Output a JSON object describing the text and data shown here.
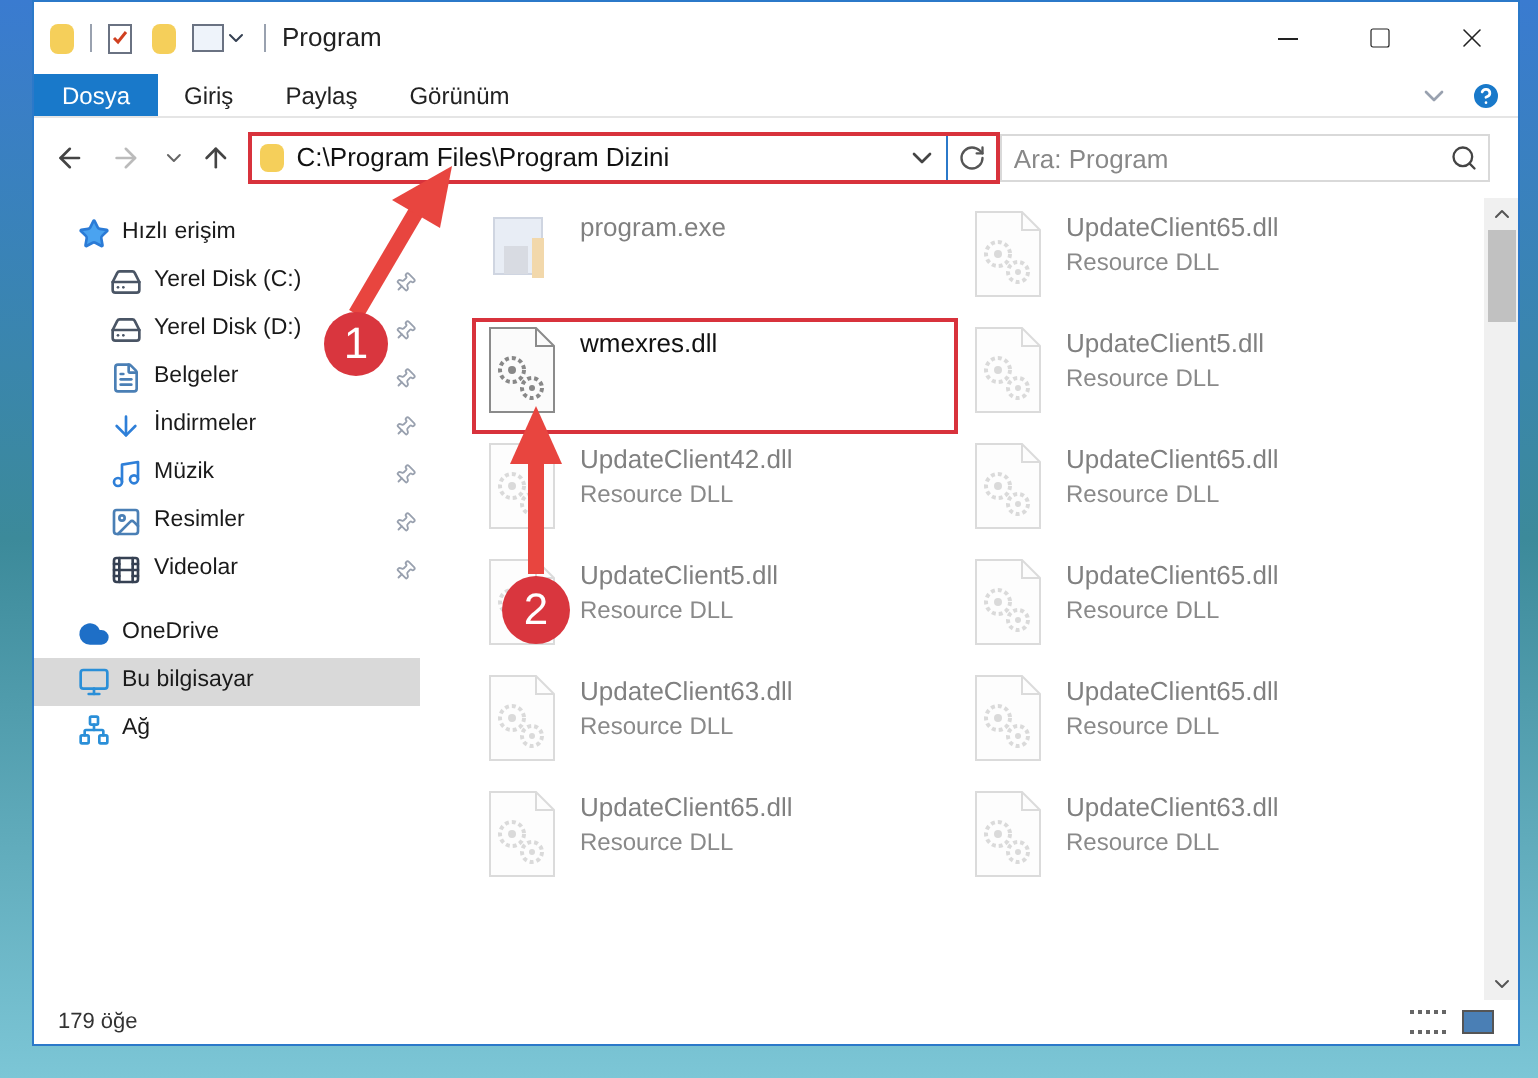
{
  "window": {
    "title": "Program"
  },
  "ribbon_tabs": [
    {
      "label": "Dosya",
      "selected": true
    },
    {
      "label": "Giriş",
      "selected": false
    },
    {
      "label": "Paylaş",
      "selected": false
    },
    {
      "label": "Görünüm",
      "selected": false
    }
  ],
  "address_bar": {
    "path": "C:\\Program Files\\Program Dizini"
  },
  "search": {
    "placeholder": "Ara: Program"
  },
  "sidebar": {
    "items": [
      {
        "label": "Hızlı erişim",
        "kind": "star",
        "pinned": false,
        "selected": false,
        "children": [
          {
            "label": "Yerel Disk (C:)",
            "kind": "drive-windows",
            "pinned": true,
            "selected": false
          },
          {
            "label": "Yerel Disk (D:)",
            "kind": "drive",
            "pinned": true,
            "selected": false
          },
          {
            "label": "Belgeler",
            "kind": "documents",
            "pinned": true,
            "selected": false
          },
          {
            "label": "İndirmeler",
            "kind": "downloads",
            "pinned": true,
            "selected": false
          },
          {
            "label": "Müzik",
            "kind": "music",
            "pinned": true,
            "selected": false
          },
          {
            "label": "Resimler",
            "kind": "pictures",
            "pinned": true,
            "selected": false
          },
          {
            "label": "Videolar",
            "kind": "videos",
            "pinned": true,
            "selected": false
          }
        ]
      },
      {
        "label": "OneDrive",
        "kind": "cloud",
        "pinned": false,
        "selected": false
      },
      {
        "label": "Bu bilgisayar",
        "kind": "computer",
        "pinned": false,
        "selected": true
      },
      {
        "label": "Ağ",
        "kind": "network",
        "pinned": false,
        "selected": false
      }
    ]
  },
  "files": [
    {
      "name": "program.exe",
      "kind": "exe",
      "highlighted": false
    },
    {
      "name": "UpdateClient65.dll",
      "type": "Resource DLL",
      "kind": "dll",
      "highlighted": false
    },
    {
      "name": "wmexres.dll",
      "kind": "dll",
      "highlighted": true
    },
    {
      "name": "UpdateClient5.dll",
      "type": "Resource DLL",
      "kind": "dll",
      "highlighted": false
    },
    {
      "name": "UpdateClient42.dll",
      "type": "Resource DLL",
      "kind": "dll",
      "highlighted": false
    },
    {
      "name": "UpdateClient65.dll",
      "type": "Resource DLL",
      "kind": "dll",
      "highlighted": false
    },
    {
      "name": "UpdateClient5.dll",
      "type": "Resource DLL",
      "kind": "dll",
      "highlighted": false
    },
    {
      "name": "UpdateClient65.dll",
      "type": "Resource DLL",
      "kind": "dll",
      "highlighted": false
    },
    {
      "name": "UpdateClient63.dll",
      "type": "Resource DLL",
      "kind": "dll",
      "highlighted": false
    },
    {
      "name": "UpdateClient65.dll",
      "type": "Resource DLL",
      "kind": "dll",
      "highlighted": false
    },
    {
      "name": "UpdateClient65.dll",
      "type": "Resource DLL",
      "kind": "dll",
      "highlighted": false
    },
    {
      "name": "UpdateClient63.dll",
      "type": "Resource DLL",
      "kind": "dll",
      "highlighted": false
    }
  ],
  "status_bar": {
    "count": "179 öğe"
  },
  "annotations": [
    {
      "number": "1"
    },
    {
      "number": "2"
    }
  ]
}
